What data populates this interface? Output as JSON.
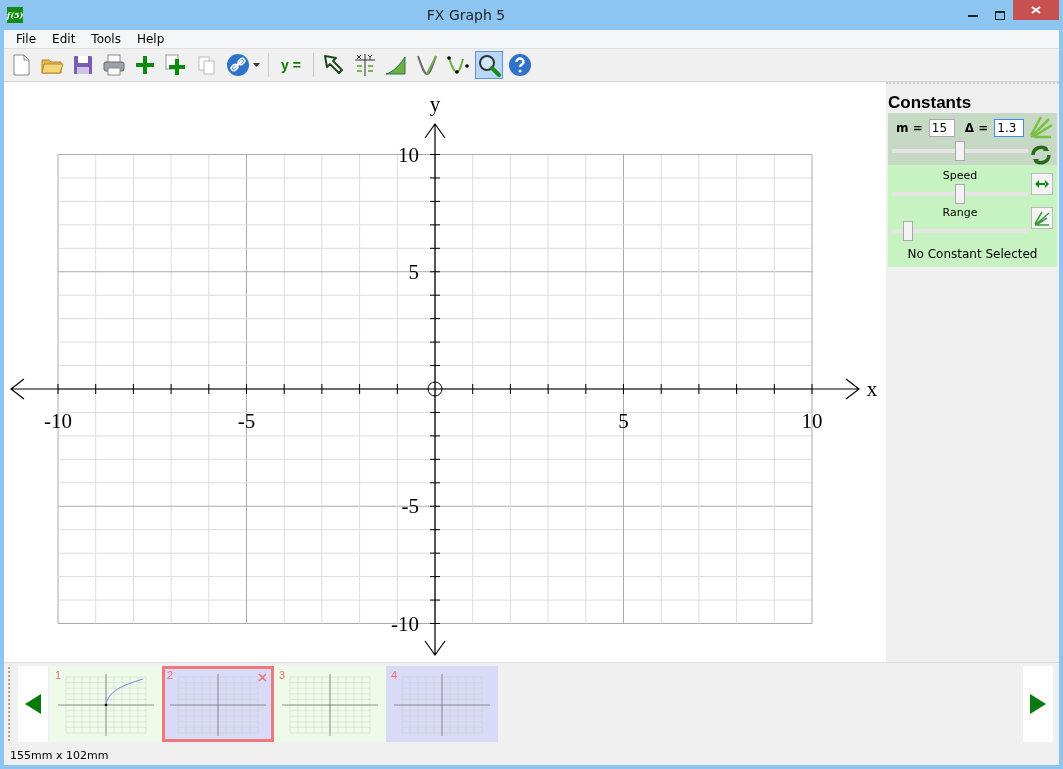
{
  "window": {
    "title": "FX Graph 5",
    "app_icon": "f(5)"
  },
  "menu": [
    "File",
    "Edit",
    "Tools",
    "Help"
  ],
  "toolbar": [
    {
      "kind": "page",
      "selected": false
    },
    {
      "kind": "folder",
      "selected": false
    },
    {
      "kind": "disk",
      "selected": false
    },
    {
      "kind": "printer",
      "selected": false
    },
    {
      "kind": "plus",
      "selected": false
    },
    {
      "kind": "plusdoc",
      "selected": false
    },
    {
      "kind": "copy",
      "selected": false
    },
    {
      "kind": "link",
      "selected": false
    },
    {
      "kind": "separator"
    },
    {
      "kind": "text",
      "label": "y =",
      "selected": false
    },
    {
      "kind": "separator"
    },
    {
      "kind": "arrow",
      "selected": false
    },
    {
      "kind": "table",
      "selected": false
    },
    {
      "kind": "area",
      "selected": false
    },
    {
      "kind": "vcurve",
      "selected": false
    },
    {
      "kind": "points",
      "selected": false
    },
    {
      "kind": "magnifier",
      "selected": true
    },
    {
      "kind": "help",
      "selected": false
    }
  ],
  "graph": {
    "x_label": "x",
    "y_label": "y",
    "x_tick_labels": [
      "-10",
      "-5",
      "5",
      "10"
    ],
    "y_tick_labels": [
      "10",
      "5",
      "-5",
      "-10"
    ]
  },
  "constants": {
    "title": "Constants",
    "constant_label": "m =",
    "constant_value": "15",
    "delta_label": "Δ =",
    "delta_value": "1.3",
    "value_slider": {
      "level": 0.5
    },
    "speed": {
      "label": "Speed",
      "level": 0.5
    },
    "range": {
      "label": "Range",
      "level": 0.12
    },
    "status": "No Constant Selected"
  },
  "pages": [
    {
      "number": "1",
      "selected": false,
      "color": "#eefbe9",
      "kind": "curve"
    },
    {
      "number": "2",
      "selected": true,
      "color": "#d9d9f8",
      "kind": "blank"
    },
    {
      "number": "3",
      "selected": false,
      "color": "#eefbe9",
      "kind": "blank"
    },
    {
      "number": "4",
      "selected": false,
      "color": "#d9d9f8",
      "kind": "blank"
    }
  ],
  "status_bar": "155mm x 102mm"
}
